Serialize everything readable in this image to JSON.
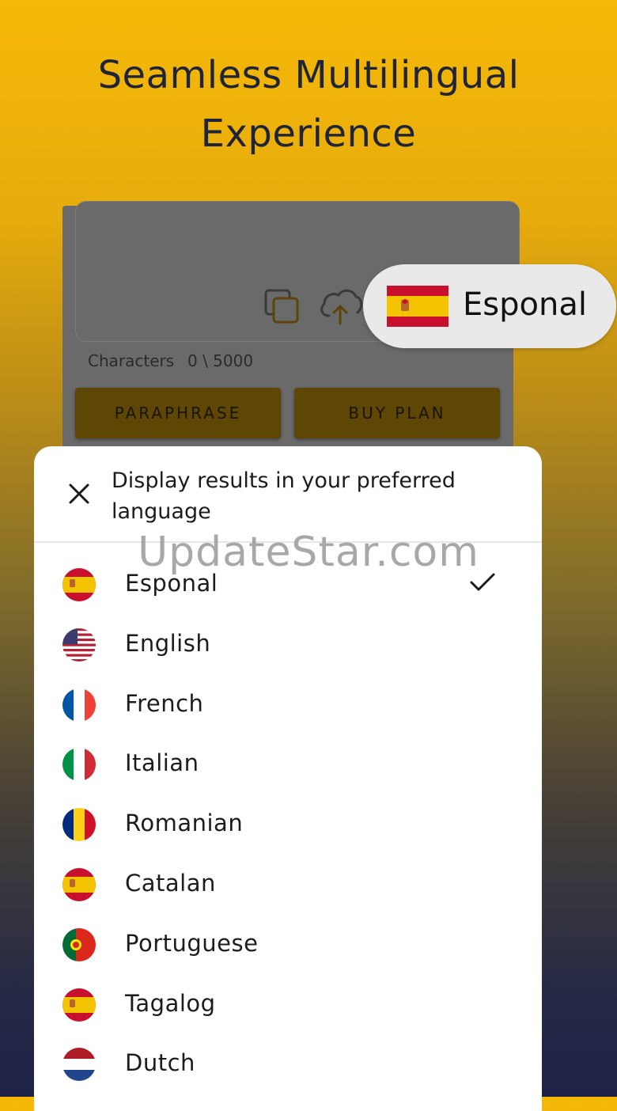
{
  "promo": {
    "headline_line1": "Seamless Multilingual",
    "headline_line2": "Experience"
  },
  "app": {
    "characters_label": "Characters",
    "characters_count": "0 \\ 5000",
    "paraphrase_button": "PARAPHRASE",
    "buy_plan_button": "BUY PLAN",
    "icons": [
      "copy-icon",
      "cloud-upload-icon"
    ]
  },
  "selected_language_pill": {
    "label": "Esponal",
    "flag": "spain-flag"
  },
  "language_sheet": {
    "title": "Display results in your preferred language",
    "watermark": "UpdateStar.com",
    "items": [
      {
        "label": "Esponal",
        "flag": "spain",
        "selected": true
      },
      {
        "label": "English",
        "flag": "usa",
        "selected": false
      },
      {
        "label": "French",
        "flag": "france",
        "selected": false
      },
      {
        "label": "Italian",
        "flag": "italy",
        "selected": false
      },
      {
        "label": "Romanian",
        "flag": "romania",
        "selected": false
      },
      {
        "label": "Catalan",
        "flag": "spain",
        "selected": false
      },
      {
        "label": "Portuguese",
        "flag": "portugal",
        "selected": false
      },
      {
        "label": "Tagalog",
        "flag": "spain",
        "selected": false
      },
      {
        "label": "Dutch",
        "flag": "netherlands",
        "selected": false
      }
    ]
  },
  "colors": {
    "gradient_top": "#f6b908",
    "gradient_bottom": "#1d2247",
    "headline": "#1f2438",
    "button_bg": "#5e4604"
  }
}
